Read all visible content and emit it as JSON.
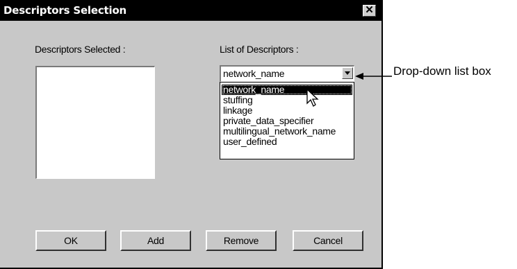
{
  "dialog": {
    "title": "Descriptors Selection",
    "close_glyph": "✕",
    "selected_label": "Descriptors Selected :",
    "list_label": "List of Descriptors :",
    "combo_value": "network_name",
    "options": [
      "network_name",
      "stuffing",
      "linkage",
      "private_data_specifier",
      "multilingual_network_name",
      "user_defined"
    ],
    "highlighted_option": "network_name",
    "buttons": {
      "ok": "OK",
      "add": "Add",
      "remove": "Remove",
      "cancel": "Cancel"
    }
  },
  "annotation": {
    "callout_text": "Drop-down list box"
  },
  "icons": {
    "close": "close-icon",
    "dropdown": "chevron-down-icon",
    "cursor": "mouse-pointer-icon"
  }
}
